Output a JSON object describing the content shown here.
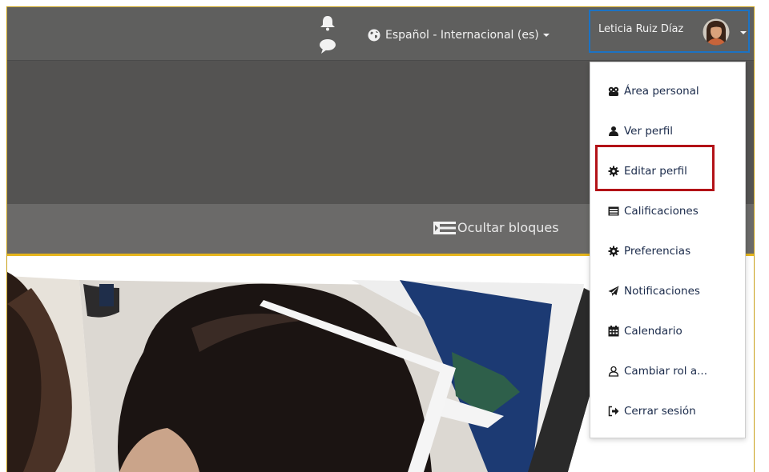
{
  "navbar": {
    "notification_icon": "bell-icon",
    "messages_icon": "chat-bubble-icon",
    "language": {
      "icon": "globe-icon",
      "label": "Español - Internacional (es)"
    },
    "user": {
      "name": "Leticia Ruiz Díaz",
      "avatar": "avatar-photo"
    }
  },
  "block_bar": {
    "icon": "blocks-toggle-icon",
    "label": "Ocultar bloques"
  },
  "user_menu": {
    "items": [
      {
        "label": "Área personal",
        "icon": "dashboard-icon"
      },
      {
        "label": "Ver perfil",
        "icon": "user-icon"
      },
      {
        "label": "Editar perfil",
        "icon": "cog-icon"
      },
      {
        "label": "Calificaciones",
        "icon": "table-icon"
      },
      {
        "label": "Preferencias",
        "icon": "cog-icon"
      },
      {
        "label": "Notificaciones",
        "icon": "paper-plane-icon"
      },
      {
        "label": "Calendario",
        "icon": "calendar-icon"
      },
      {
        "label": "Cambiar rol a...",
        "icon": "user-outline-icon"
      },
      {
        "label": "Cerrar sesión",
        "icon": "sign-out-icon"
      }
    ],
    "highlighted_item": "Editar perfil"
  },
  "colors": {
    "navbar": "#5f5f5e",
    "header_band": "#545352",
    "block_bar": "#6b6a69",
    "accent_gold": "#e5b51c",
    "focus_blue": "#1c73c4",
    "highlight_red": "#b31217",
    "menu_text": "#1a2a4a"
  }
}
